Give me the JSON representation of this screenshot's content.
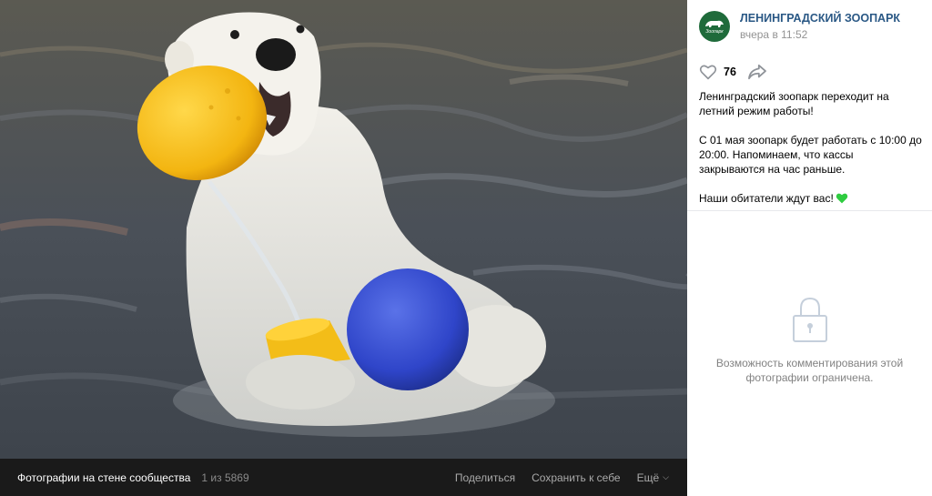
{
  "viewer": {
    "album_title": "Фотографии на стене сообщества",
    "counter": "1 из 5869",
    "share_label": "Поделиться",
    "save_label": "Сохранить к себе",
    "more_label": "Ещё"
  },
  "post": {
    "author": "ЛЕНИНГРАДСКИЙ ЗООПАРК",
    "avatar_text": "Зоопарк",
    "time": "вчера в 11:52",
    "likes": "76",
    "paragraphs": [
      "Ленинградский зоопарк переходит на летний режим работы!",
      "С 01 мая зоопарк будет работать с 10:00 до 20:00. Напоминаем, что кассы закрываются на час раньше.",
      "Наши обитатели ждут вас!"
    ]
  },
  "comments": {
    "notice": "Возможность комментирования этой фотографии ограничена."
  },
  "colors": {
    "link": "#2a5885",
    "avatar_bg": "#1f6b3b",
    "bar_bg": "#1a1a1a",
    "heart_emoji": "#2ecc40"
  },
  "icons": [
    "like-heart-icon",
    "share-arrow-icon",
    "green-heart-emoji-icon",
    "lock-icon",
    "chevron-down-icon",
    "polar-bear-logo-icon"
  ]
}
